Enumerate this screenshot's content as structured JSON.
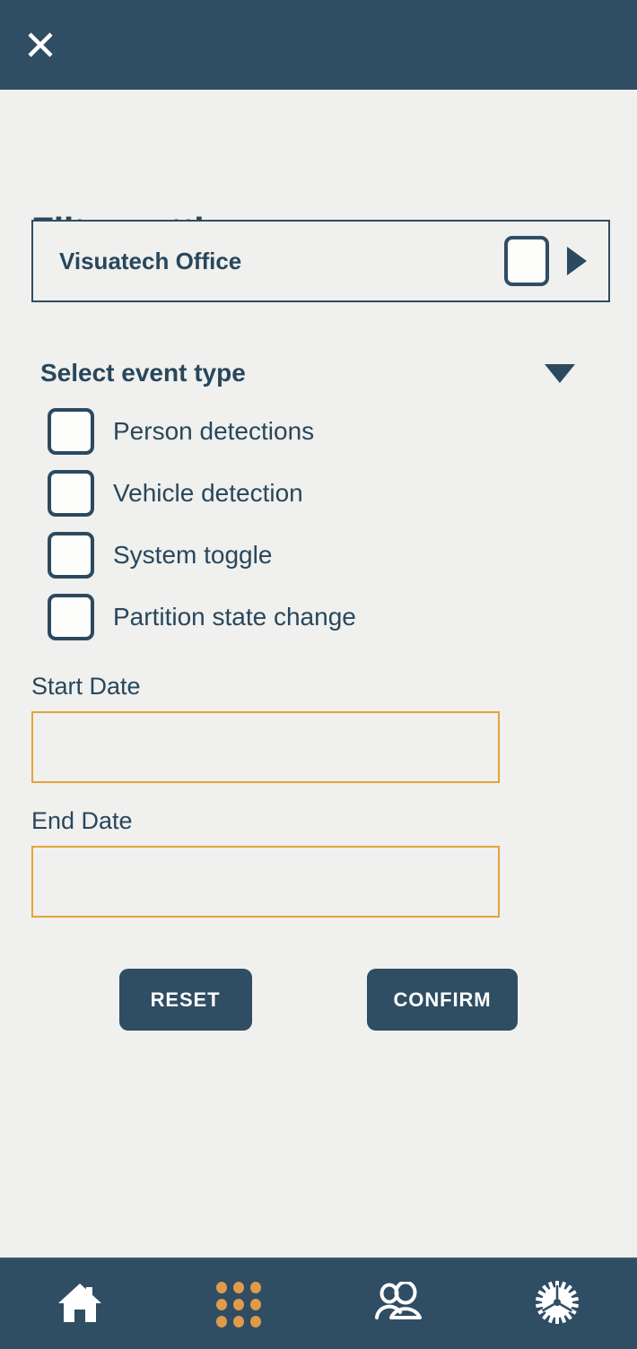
{
  "topbar": {
    "close_icon": "close-icon"
  },
  "page": {
    "title": "Filter settings"
  },
  "site_selector": {
    "name": "Visuatech Office",
    "checkbox_checked": false,
    "expand_icon": "triangle-right-icon"
  },
  "event_type": {
    "heading": "Select event type",
    "collapse_icon": "triangle-down-icon",
    "options": [
      {
        "label": "Person detections",
        "checked": false
      },
      {
        "label": "Vehicle detection",
        "checked": false
      },
      {
        "label": "System toggle",
        "checked": false
      },
      {
        "label": "Partition state change",
        "checked": false
      }
    ]
  },
  "dates": {
    "start": {
      "label": "Start Date",
      "value": "",
      "placeholder": ""
    },
    "end": {
      "label": "End Date",
      "value": "",
      "placeholder": ""
    }
  },
  "actions": {
    "reset_label": "RESET",
    "confirm_label": "CONFIRM"
  },
  "bottom_nav": {
    "items": [
      {
        "icon": "home-icon",
        "active": false
      },
      {
        "icon": "grid-icon",
        "active": true
      },
      {
        "icon": "people-icon",
        "active": false
      },
      {
        "icon": "gear-icon",
        "active": false
      }
    ]
  },
  "colors": {
    "navy": "#2f4d63",
    "text_navy": "#28475c",
    "background": "#f0f0ee",
    "accent_orange": "#e09a4a",
    "input_border_orange": "#e5a33c"
  }
}
